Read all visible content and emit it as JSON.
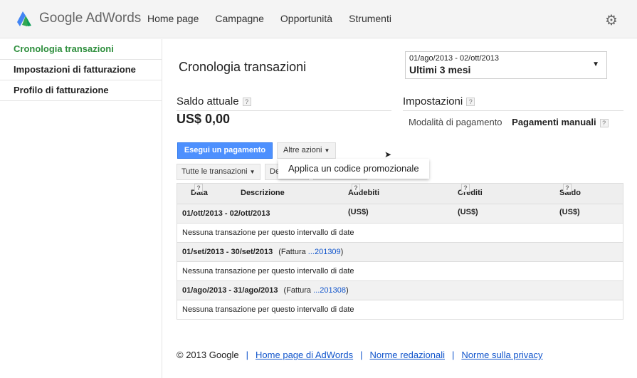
{
  "header": {
    "logo": "Google AdWords",
    "nav": [
      "Home page",
      "Campagne",
      "Opportunità",
      "Strumenti"
    ]
  },
  "sidebar": {
    "items": [
      "Cronologia transazioni",
      "Impostazioni di fatturazione",
      "Profilo di fatturazione"
    ]
  },
  "main": {
    "title": "Cronologia transazioni",
    "date_range": {
      "dates": "01/ago/2013 - 02/ott/2013",
      "label": "Ultimi 3 mesi"
    },
    "balance": {
      "label": "Saldo attuale",
      "value": "US$ 0,00"
    },
    "settings": {
      "label": "Impostazioni",
      "payment_mode_label": "Modalità di pagamento",
      "payment_mode_value": "Pagamenti manuali"
    },
    "buttons": {
      "pay": "Esegui un pagamento",
      "more": "Altre azioni",
      "filter": "Tutte le transazioni",
      "filter2": "De"
    },
    "menu": {
      "items": [
        "Applica un codice promozionale"
      ]
    },
    "table": {
      "columns": [
        "Data",
        "Descrizione",
        "Addebiti (US$)",
        "Crediti (US$)",
        "Saldo (US$)"
      ],
      "groups": [
        {
          "range": "01/ott/2013 - 02/ott/2013",
          "invoice_prefix": "",
          "invoice_link": "",
          "invoice_suffix": "",
          "message": "Nessuna transazione per questo intervallo di date"
        },
        {
          "range": "01/set/2013 - 30/set/2013",
          "invoice_prefix": "(Fattura ",
          "invoice_link": "...201309",
          "invoice_suffix": ")",
          "message": "Nessuna transazione per questo intervallo di date"
        },
        {
          "range": "01/ago/2013 - 31/ago/2013",
          "invoice_prefix": "(Fattura ",
          "invoice_link": "...201308",
          "invoice_suffix": ")",
          "message": "Nessuna transazione per questo intervallo di date"
        }
      ]
    }
  },
  "footer": {
    "copyright": "© 2013 Google",
    "links": [
      "Home page di AdWords",
      "Norme redazionali",
      "Norme sulla privacy"
    ],
    "separator": "|"
  },
  "help": "?"
}
